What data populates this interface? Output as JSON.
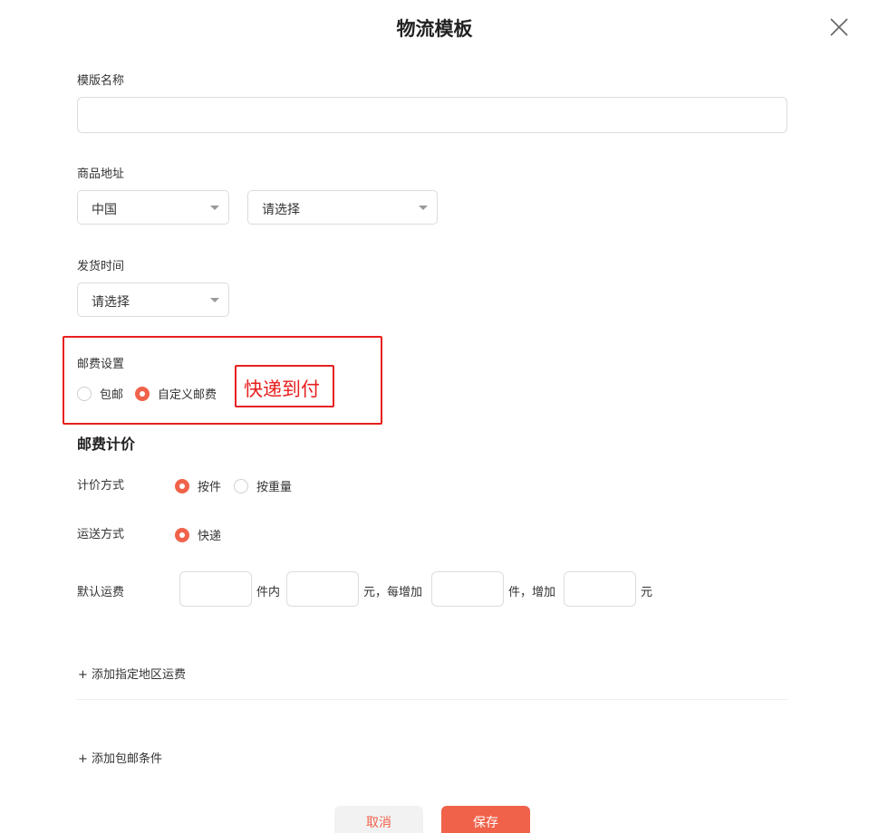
{
  "dialog": {
    "title": "物流模板",
    "close_icon": "close-icon"
  },
  "template_name": {
    "label": "模版名称",
    "value": "",
    "placeholder": ""
  },
  "address": {
    "label": "商品地址",
    "country": "中国",
    "region": "请选择"
  },
  "ship_time": {
    "label": "发货时间",
    "value": "请选择"
  },
  "postage_setting": {
    "label": "邮费设置",
    "options": [
      {
        "label": "包邮",
        "selected": false
      },
      {
        "label": "自定义邮费",
        "selected": true
      }
    ],
    "annotation": "快递到付"
  },
  "pricing": {
    "section_title": "邮费计价",
    "method": {
      "label": "计价方式",
      "options": [
        {
          "label": "按件",
          "selected": true
        },
        {
          "label": "按重量",
          "selected": false
        }
      ]
    },
    "delivery": {
      "label": "运送方式",
      "options": [
        {
          "label": "快递",
          "selected": true
        }
      ]
    },
    "default_fee": {
      "label": "默认运费",
      "unit1": "件内",
      "unit2": "元，每增加",
      "unit3": "件，增加",
      "unit4": "元",
      "values": [
        "",
        "",
        "",
        ""
      ]
    }
  },
  "links": {
    "add_region": "+ 添加指定地区运费",
    "add_free_condition": "+ 添加包邮条件"
  },
  "buttons": {
    "cancel": "取消",
    "save": "保存"
  },
  "colors": {
    "accent": "#f0624a",
    "annotation": "#e82020"
  }
}
